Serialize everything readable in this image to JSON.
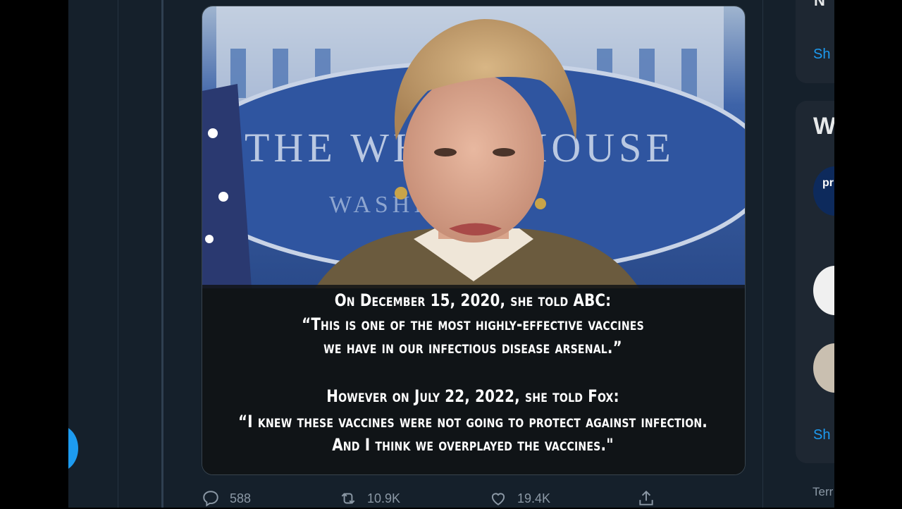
{
  "tweet": {
    "media": {
      "backdrop_text": "THE WHITE HOUSE",
      "backdrop_subtext": "WASHINGTON",
      "caption_lines": [
        "On December 15, 2020, she told ABC:",
        "“This is one of the most highly-effective vaccines",
        "we have in our infectious disease arsenal.”",
        "However on July 22, 2022, she told Fox:",
        "“I knew these vaccines were not going to protect against infection.",
        "And I think we overplayed the vaccines.\""
      ]
    },
    "actions": {
      "reply_count": "588",
      "retweet_count": "10.9K",
      "like_count": "19.4K"
    }
  },
  "sidebar": {
    "top_card_heading": "N",
    "show_more_1": "Sh",
    "who_heading": "W",
    "avatar_1_text": "pr vi",
    "show_more_2": "Sh",
    "footer_terms": "Terr"
  },
  "colors": {
    "background": "#15202b",
    "card": "#1e2732",
    "accent": "#1d9bf0",
    "muted": "#8b98a5"
  }
}
